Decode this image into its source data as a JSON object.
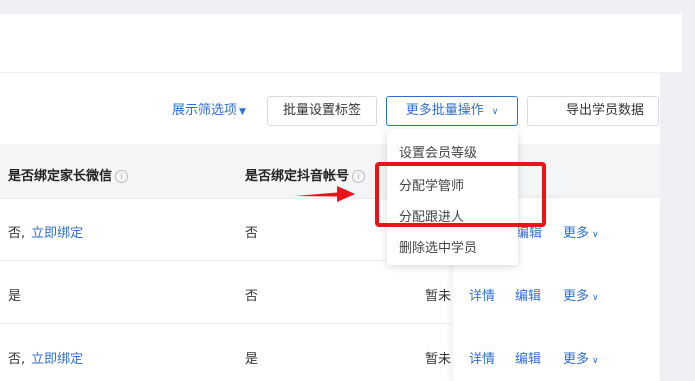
{
  "toolbar": {
    "filter_toggle": "展示筛选项",
    "batch_label_button": "批量设置标签",
    "more_batch_button": "更多批量操作",
    "export_button": "导出学员数据"
  },
  "table": {
    "headers": [
      "是否绑定家长微信",
      "是否绑定抖音帐号"
    ],
    "rows": [
      {
        "wechat": "否,",
        "wechat_link": "立即绑定",
        "douyin": "否",
        "status": "",
        "ops": [
          "详情",
          "编辑",
          "更多"
        ]
      },
      {
        "wechat": "是",
        "wechat_link": "",
        "douyin": "否",
        "status": "暂未",
        "ops": [
          "详情",
          "编辑",
          "更多"
        ]
      },
      {
        "wechat": "否,",
        "wechat_link": "立即绑定",
        "douyin": "是",
        "status": "暂未",
        "ops": [
          "详情",
          "编辑",
          "更多"
        ]
      }
    ]
  },
  "dropdown": {
    "items": [
      "设置会员等级",
      "分配学管师",
      "分配跟进人",
      "删除选中学员"
    ]
  },
  "colors": {
    "accent": "#2f6fd0",
    "highlight": "#e8141a"
  }
}
